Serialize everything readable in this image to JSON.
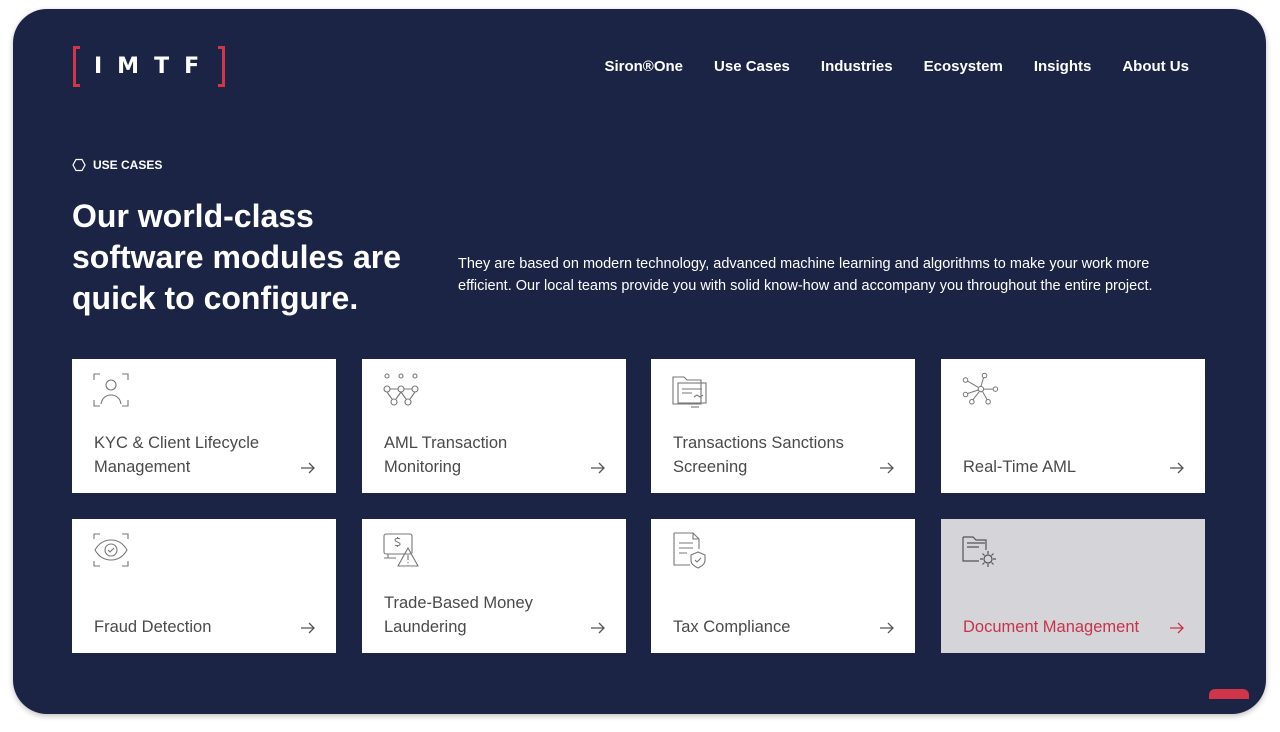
{
  "header": {
    "logo_text": "IMTF",
    "nav": [
      "Siron®One",
      "Use Cases",
      "Industries",
      "Ecosystem",
      "Insights",
      "About Us"
    ]
  },
  "hero": {
    "eyebrow": "USE CASES",
    "title": "Our world-class software modules are quick to configure.",
    "description": "They are based on modern technology, advanced machine learning and algorithms to make your work more efficient. Our local teams provide you with solid know-how and accompany you throughout the entire project."
  },
  "cards": [
    {
      "label": "KYC & Client Lifecycle Management",
      "icon": "face-scan-icon"
    },
    {
      "label": "AML Transaction Monitoring",
      "icon": "network-dots-icon"
    },
    {
      "label": "Transactions Sanctions Screening",
      "icon": "folder-document-icon"
    },
    {
      "label": "Real-Time AML",
      "icon": "node-network-icon"
    },
    {
      "label": "Fraud Detection",
      "icon": "eye-scan-icon"
    },
    {
      "label": "Trade-Based Money Laundering",
      "icon": "money-warning-icon"
    },
    {
      "label": "Tax Compliance",
      "icon": "document-shield-icon"
    },
    {
      "label": "Document Management",
      "icon": "folder-gear-icon",
      "active": true
    }
  ],
  "colors": {
    "background": "#1c2446",
    "accent": "#d0354a",
    "card": "#ffffff",
    "card_active": "#d4d4d9"
  }
}
